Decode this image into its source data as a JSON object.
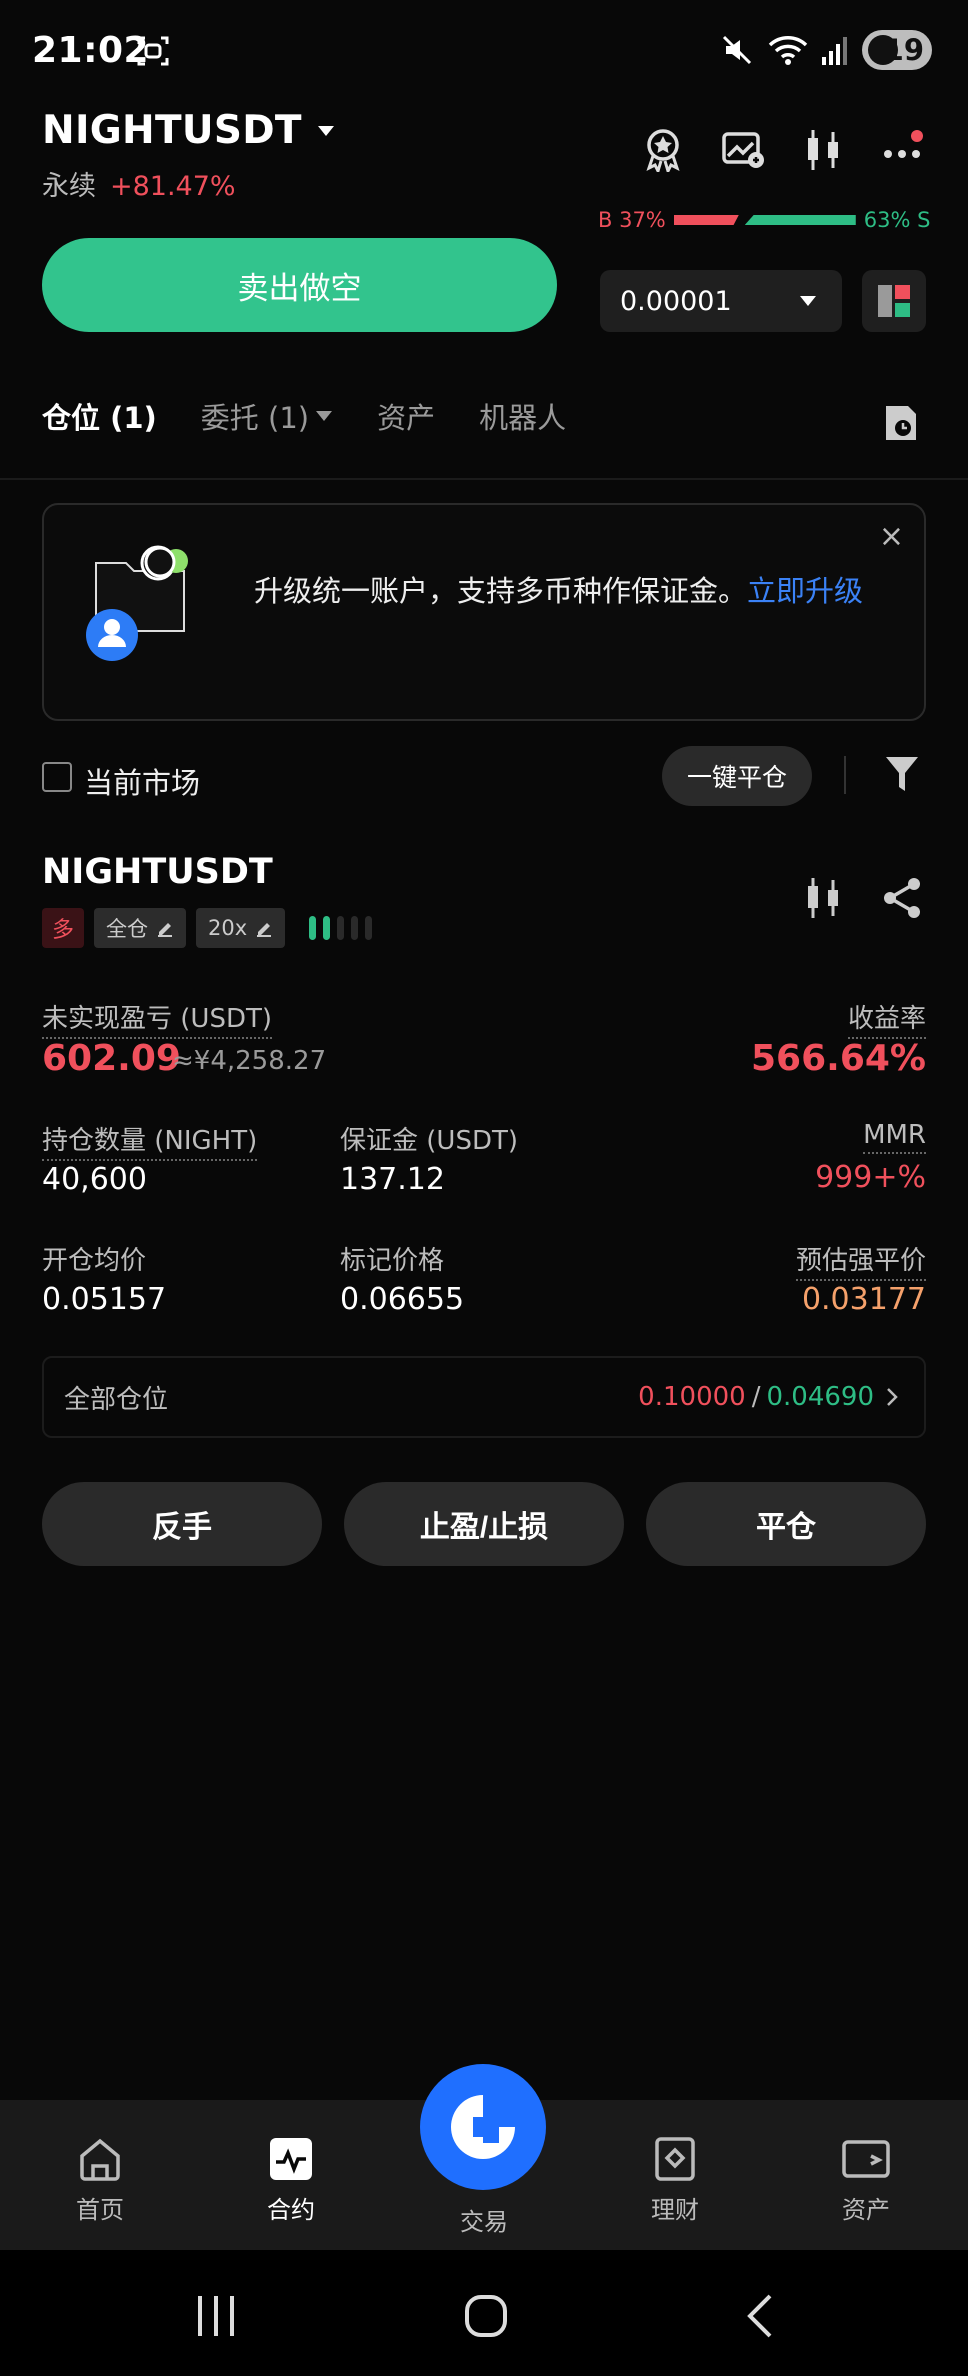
{
  "status": {
    "time": "21:02",
    "battery": "19"
  },
  "header": {
    "pair": "NIGHTUSDT",
    "type": "永续",
    "change": "+81.47%"
  },
  "book_ratio": {
    "buy": "B 37%",
    "sell": "63% S",
    "buy_fraction": 0.37
  },
  "order": {
    "sell_button": "卖出做空",
    "step_value": "0.00001"
  },
  "tabs": [
    {
      "label": "仓位 (1)",
      "active": true
    },
    {
      "label": "委托 (1)",
      "has_caret": true
    },
    {
      "label": "资产"
    },
    {
      "label": "机器人"
    }
  ],
  "banner": {
    "text": "升级统一账户，支持多币种作保证金。",
    "link": "立即升级",
    "close": "×"
  },
  "filter": {
    "current_market": "当前市场",
    "close_all": "一键平仓"
  },
  "position": {
    "symbol": "NIGHTUSDT",
    "direction": "多",
    "margin_mode": "全仓",
    "leverage": "20x",
    "adl_level": 2,
    "pnl_label": "未实现盈亏 (USDT)",
    "pnl": "602.09",
    "pnl_cny": "≈¥4,258.27",
    "roe_label": "收益率",
    "roe": "566.64%",
    "size_label": "持仓数量 (NIGHT)",
    "size": "40,600",
    "margin_label": "保证金 (USDT)",
    "margin": "137.12",
    "mmr_label": "MMR",
    "mmr": "999+%",
    "entry_label": "开仓均价",
    "entry": "0.05157",
    "mark_label": "标记价格",
    "mark": "0.06655",
    "liq_label": "预估强平价",
    "liq": "0.03177"
  },
  "all_positions": {
    "label": "全部仓位",
    "red": "0.10000",
    "sep": "/",
    "green": "0.04690"
  },
  "actions": {
    "reverse": "反手",
    "tpsl": "止盈/止损",
    "close": "平仓"
  },
  "nav": {
    "home": "首页",
    "futures": "合约",
    "trade": "交易",
    "earn": "理财",
    "assets": "资产"
  },
  "colors": {
    "buy": "#2ebd85",
    "sell": "#f0505c",
    "accent": "#1f6fff"
  }
}
